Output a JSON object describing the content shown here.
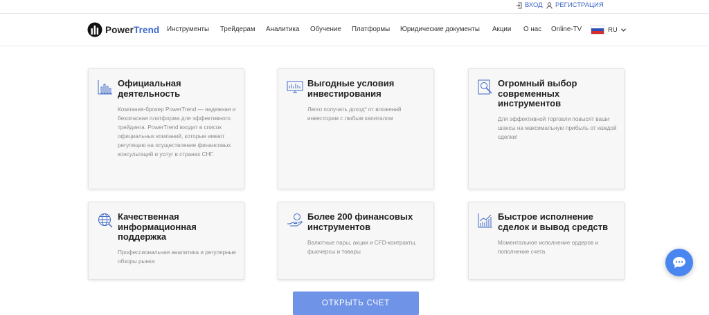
{
  "topbar": {
    "login": "ВХОД",
    "register": "РЕГИСТРАЦИЯ"
  },
  "logo": {
    "part1": "Power",
    "part2": "Trend"
  },
  "nav": [
    "Инструменты",
    "Трейдерам",
    "Аналитика",
    "Обучение",
    "Платформы",
    "Юридические документы",
    "Акции",
    "О нас",
    "Online-TV"
  ],
  "lang": {
    "selected": "RU"
  },
  "colors": {
    "accent": "#3d68c8",
    "button": "#6f93e6",
    "chat": "#4a86f0"
  },
  "cards": [
    {
      "icon": "bar-chart-icon",
      "title": "Официальная деятельность",
      "text": "Компания-брокер PowerTrend — надежная и безопасная платформа для эффективного трейдинга. PowerTrend входит в список официальных компаний, которые имеют регуляцию на осуществление финансовых консультаций и услуг в странах СНГ."
    },
    {
      "icon": "monitor-chart-icon",
      "title": "Выгодные условия инвестирования",
      "text": "Легко получать доход* от вложений инвесторам с любым капиталом"
    },
    {
      "icon": "search-document-icon",
      "title": "Огромный выбор современных инструментов",
      "text": "Для эффективной торговли повысят ваши шансы на максимальную прибыль от каждой сделки!"
    },
    {
      "icon": "globe-support-icon",
      "title": "Качественная информационная поддержка",
      "text": "Профессиональная аналитика и регулярные обзоры рынка"
    },
    {
      "icon": "hand-coin-icon",
      "title": "Более 200 финансовых инструментов",
      "text": "Валютные пары, акции и CFD-контракты, фьючерсы и товары"
    },
    {
      "icon": "growth-chart-icon",
      "title": "Быстрое исполнение сделок и вывод средств",
      "text": "Моментальное исполнение ордеров и пополнение счета"
    }
  ],
  "cta": {
    "label": "ОТКРЫТЬ СЧЕТ"
  }
}
